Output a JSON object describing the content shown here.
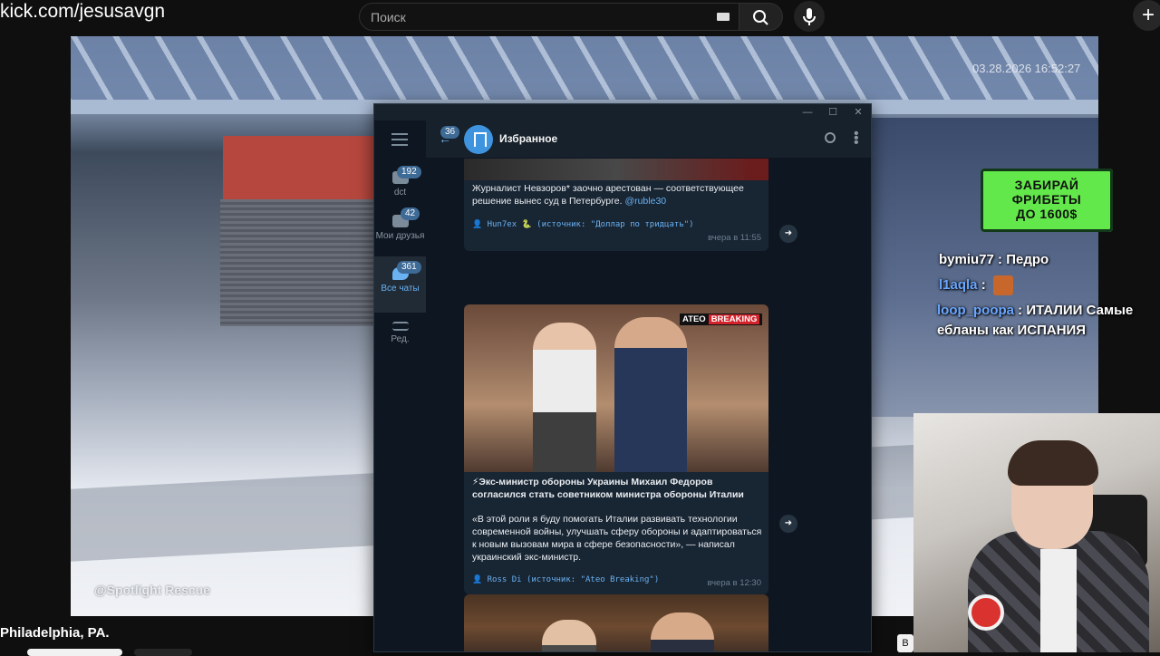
{
  "browser": {
    "url": "kick.com/jesusavgn",
    "search_placeholder": "Поиск",
    "plus": "+"
  },
  "stream": {
    "timestamp": "03.28.2026 16:52:27",
    "watermark": "@Spotlight Rescue",
    "location": "Philadelphia, PA."
  },
  "promo": {
    "line1": "ЗАБИРАЙ",
    "line2": "ФРИБЕТЫ",
    "line3": "ДО 1600$"
  },
  "chat": [
    {
      "user": "bymiu77",
      "text": "Педро"
    },
    {
      "user": "l1aqla",
      "text": ""
    },
    {
      "user": "loop_poopa",
      "text": "ИТАЛИИ Самые ебланы как ИСПАНИЯ"
    }
  ],
  "telegram": {
    "window_controls": {
      "min": "—",
      "max": "☐",
      "close": "✕"
    },
    "header": {
      "back_badge": "36",
      "chat_title": "Избранное"
    },
    "folders": [
      {
        "label": "dct",
        "badge": "192"
      },
      {
        "label": "Мои друзья",
        "badge": "42"
      },
      {
        "label": "Все чаты",
        "badge": "361"
      },
      {
        "label": "Ред.",
        "badge": ""
      }
    ],
    "posts": [
      {
        "text": "Журналист Невзоров* заочно арестован — соответствующее решение вынес суд в Петербурге.",
        "link": "@ruble30",
        "signature": "👤 Hun7ex 🐍 (источник: \"Доллар по тридцать\")",
        "time": "вчера в 11:55"
      },
      {
        "image_badge_left": "ATEO",
        "image_badge_right": "BREAKING",
        "headline": "⚡Экс-министр обороны Украины Михаил Федоров согласился стать советником министра обороны Италии",
        "body": "«В этой роли я буду помогать Италии развивать технологии современной войны, улучшать сферу обороны и адаптироваться к новым вызовам мира в сфере безопасности», — написал украинский экс-министр.",
        "signature": "👤 Ross Di (источник: \"Ateo Breaking\")",
        "time": "вчера в 12:30"
      }
    ]
  },
  "bottom": {
    "btn3": "B"
  }
}
